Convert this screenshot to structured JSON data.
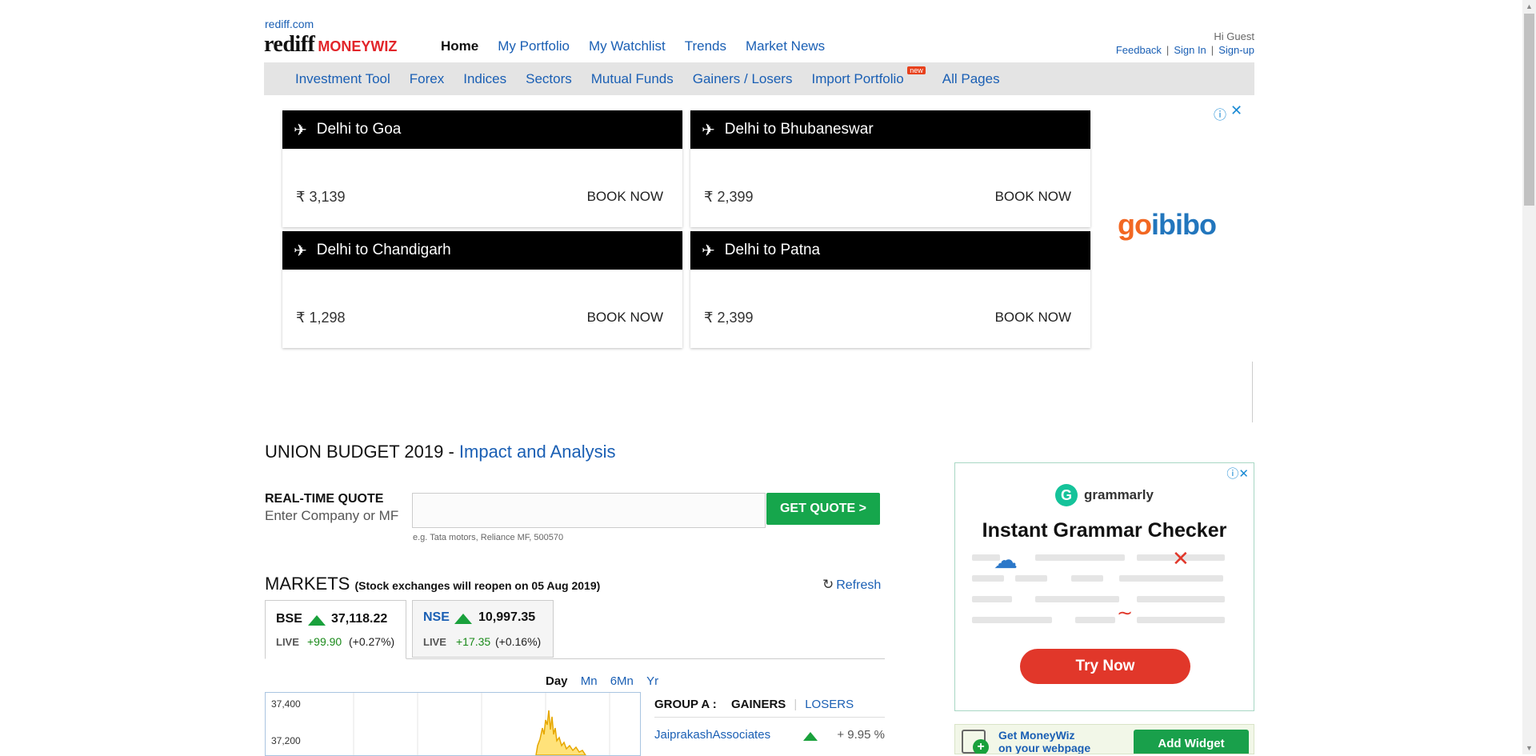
{
  "header": {
    "site_link": "rediff.com",
    "logo_main": "rediff",
    "logo_sub": "MONEYWIZ",
    "nav": [
      "Home",
      "My Portfolio",
      "My Watchlist",
      "Trends",
      "Market News"
    ],
    "greeting": "Hi Guest",
    "user_links": [
      "Feedback",
      "Sign In",
      "Sign-up"
    ],
    "separator": "|"
  },
  "subnav": {
    "items": [
      "Investment Tool",
      "Forex",
      "Indices",
      "Sectors",
      "Mutual Funds",
      "Gainers / Losers",
      "Import Portfolio",
      "All Pages"
    ],
    "new_badge": "new"
  },
  "flight_ad": {
    "info_icon": "info-icon",
    "close_icon": "close-icon",
    "cards": [
      {
        "route": "Delhi to Goa",
        "price": "₹ 3,139",
        "cta": "BOOK NOW"
      },
      {
        "route": "Delhi to Bhubaneswar",
        "price": "₹ 2,399",
        "cta": "BOOK NOW"
      },
      {
        "route": "Delhi to Chandigarh",
        "price": "₹ 1,298",
        "cta": "BOOK NOW"
      },
      {
        "route": "Delhi to Patna",
        "price": "₹ 2,399",
        "cta": "BOOK NOW"
      }
    ],
    "brand_go": "go",
    "brand_ibibo": "ibibo"
  },
  "budget": {
    "prefix": "UNION BUDGET 2019 - ",
    "link": "Impact and Analysis"
  },
  "quote": {
    "title": "REAL-TIME QUOTE",
    "subtitle": "Enter Company or MF",
    "input_value": "",
    "button": "GET QUOTE >",
    "hint": "e.g. Tata motors, Reliance MF, 500570"
  },
  "markets": {
    "title": "MARKETS",
    "note": "(Stock exchanges will reopen on 05 Aug 2019)",
    "refresh": "Refresh",
    "bse": {
      "name": "BSE",
      "value": "37,118.22",
      "live": "LIVE",
      "change": "+99.90",
      "pct": "(+0.27%)"
    },
    "nse": {
      "name": "NSE",
      "value": "10,997.35",
      "live": "LIVE",
      "change": "+17.35",
      "pct": "(+0.16%)"
    },
    "periods": [
      "Day",
      "Mn",
      "6Mn",
      "Yr"
    ],
    "active_period": "Day",
    "chart_y_ticks": [
      "37,400",
      "37,200"
    ],
    "group_label": "GROUP A :",
    "gainers_tab": "GAINERS",
    "losers_tab": "LOSERS",
    "gainers": [
      {
        "name": "JaiprakashAssociates",
        "pct": "+ 9.95 %"
      }
    ]
  },
  "grammarly_ad": {
    "brand": "grammarly",
    "headline": "Instant Grammar Checker",
    "cta": "Try Now"
  },
  "widget": {
    "line1": "Get MoneyWiz",
    "line2": "on your webpage",
    "button": "Add Widget"
  },
  "colors": {
    "link": "#1a5fb4",
    "brand_red": "#e2252a",
    "up_green": "#1aa13c",
    "quote_button": "#16a64c",
    "try_now": "#e1372a"
  }
}
